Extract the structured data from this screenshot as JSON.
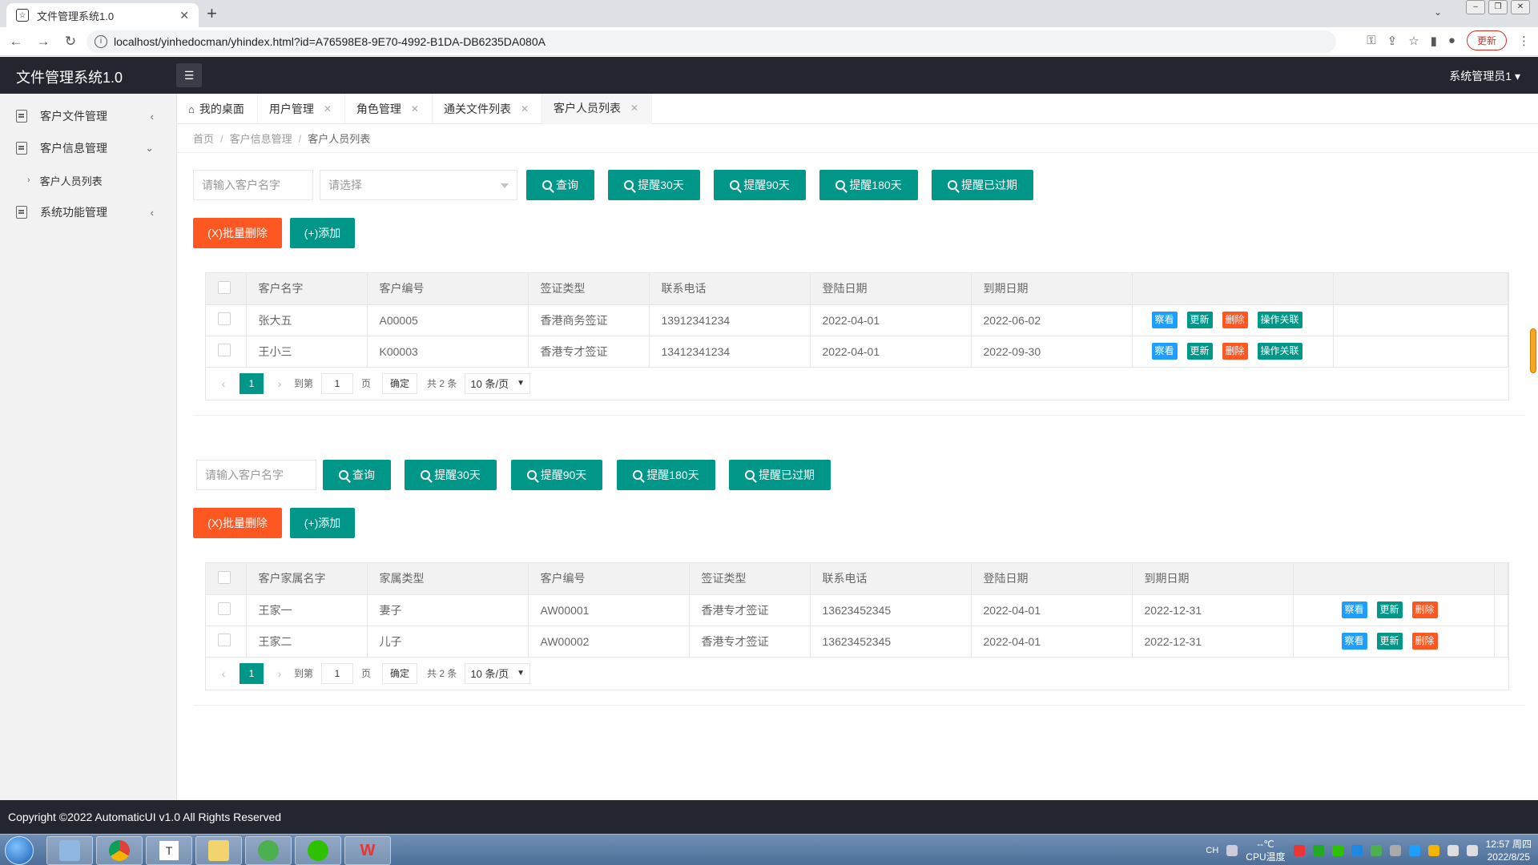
{
  "browser": {
    "tab_title": "文件管理系统1.0",
    "url": "localhost/yinhedocman/yhindex.html?id=A76598E8-9E70-4992-B1DA-DB6235DA080A",
    "update_label": "更新"
  },
  "app": {
    "title": "文件管理系统1.0",
    "user": "系统管理员1"
  },
  "sidebar": {
    "items": [
      {
        "label": "客户文件管理"
      },
      {
        "label": "客户信息管理"
      },
      {
        "label": "客户人员列表"
      },
      {
        "label": "系统功能管理"
      }
    ]
  },
  "tabs": [
    {
      "label": "我的桌面"
    },
    {
      "label": "用户管理"
    },
    {
      "label": "角色管理"
    },
    {
      "label": "通关文件列表"
    },
    {
      "label": "客户人员列表"
    }
  ],
  "breadcrumb": [
    "首页",
    "客户信息管理",
    "客户人员列表"
  ],
  "section1": {
    "search_placeholder": "请输入客户名字",
    "select_placeholder": "请选择",
    "buttons": [
      "查询",
      "提醒30天",
      "提醒90天",
      "提醒180天",
      "提醒已过期"
    ],
    "batch_delete": "(X)批量删除",
    "add": "(+)添加",
    "columns": [
      "客户名字",
      "客户编号",
      "签证类型",
      "联系电话",
      "登陆日期",
      "到期日期"
    ],
    "rows": [
      [
        "张大五",
        "A00005",
        "香港商务签证",
        "13912341234",
        "2022-04-01",
        "2022-06-02"
      ],
      [
        "王小三",
        "K00003",
        "香港专才签证",
        "13412341234",
        "2022-04-01",
        "2022-09-30"
      ]
    ],
    "actions": [
      "察看",
      "更新",
      "删除",
      "操作关联"
    ]
  },
  "section2": {
    "search_placeholder": "请输入客户名字",
    "buttons": [
      "查询",
      "提醒30天",
      "提醒90天",
      "提醒180天",
      "提醒已过期"
    ],
    "batch_delete": "(X)批量删除",
    "add": "(+)添加",
    "columns": [
      "客户家属名字",
      "家属类型",
      "客户编号",
      "签证类型",
      "联系电话",
      "登陆日期",
      "到期日期"
    ],
    "rows": [
      [
        "王家一",
        "妻子",
        "AW00001",
        "香港专才签证",
        "13623452345",
        "2022-04-01",
        "2022-12-31"
      ],
      [
        "王家二",
        "儿子",
        "AW00002",
        "香港专才签证",
        "13623452345",
        "2022-04-01",
        "2022-12-31"
      ]
    ],
    "actions": [
      "察看",
      "更新",
      "删除"
    ]
  },
  "pager": {
    "current": "1",
    "goto_label": "到第",
    "page_input": "1",
    "page_unit": "页",
    "ok": "确定",
    "total": "共 2 条",
    "page_size": "10 条/页"
  },
  "footer": "Copyright ©2022 AutomaticUI v1.0 All Rights Reserved",
  "taskbar": {
    "lang": "CH",
    "temp": "--℃",
    "cpu": "CPU温度",
    "time": "12:57 周四",
    "date": "2022/8/25"
  }
}
